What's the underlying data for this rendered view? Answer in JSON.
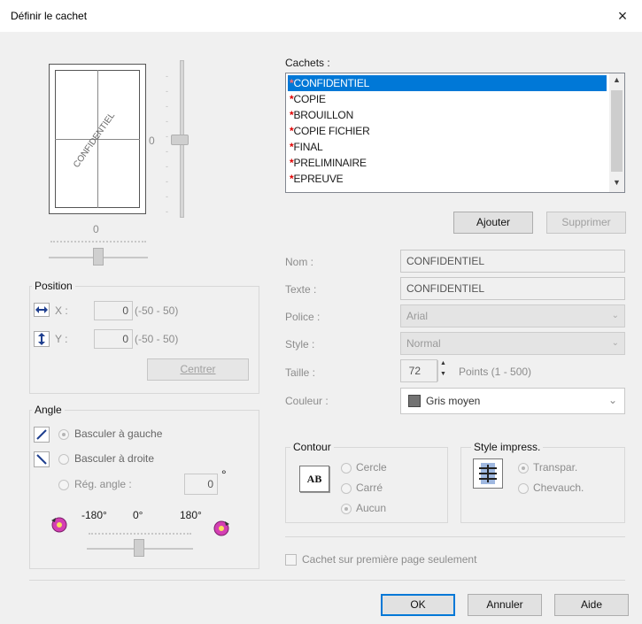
{
  "window": {
    "title": "Définir le cachet",
    "close_glyph": "×"
  },
  "preview": {
    "watermark_text": "CONFIDENTIEL",
    "vertical_value": "0",
    "horizontal_value": "0"
  },
  "stamps": {
    "label": "Cachets :",
    "items": [
      "CONFIDENTIEL",
      "COPIE",
      "BROUILLON",
      "COPIE FICHIER",
      "FINAL",
      "PRELIMINAIRE",
      "EPREUVE"
    ],
    "selected_index": 0,
    "add_button": "Ajouter",
    "delete_button": "Supprimer"
  },
  "props": {
    "name_label": "Nom :",
    "name_value": "CONFIDENTIEL",
    "text_label": "Texte :",
    "text_value": "CONFIDENTIEL",
    "font_label": "Police :",
    "font_value": "Arial",
    "style_label": "Style :",
    "style_value": "Normal",
    "size_label": "Taille :",
    "size_value": "72",
    "size_range": "Points (1 - 500)",
    "color_label": "Couleur :",
    "color_value": "Gris moyen",
    "color_swatch": "#737373"
  },
  "position": {
    "title": "Position",
    "x_label": "X :",
    "x_value": "0",
    "x_range": "(-50 - 50)",
    "y_label": "Y :",
    "y_value": "0",
    "y_range": "(-50 - 50)",
    "center_button": "Centrer"
  },
  "angle": {
    "title": "Angle",
    "option_left": "Basculer à gauche",
    "option_right": "Basculer à droite",
    "option_custom": "Rég. angle :",
    "custom_value": "0",
    "degree_symbol": "°",
    "min_label": "-180°",
    "mid_label": "0°",
    "max_label": "180°"
  },
  "outline": {
    "title": "Contour",
    "icon_text": "AB",
    "opt_circle": "Cercle",
    "opt_square": "Carré",
    "opt_none": "Aucun",
    "selected": "Aucun"
  },
  "print_style": {
    "title": "Style impress.",
    "opt_transparent": "Transpar.",
    "opt_overlap": "Chevauch.",
    "selected": "Transpar."
  },
  "first_page_only": {
    "label": "Cachet sur première page seulement",
    "checked": false
  },
  "footer": {
    "ok": "OK",
    "cancel": "Annuler",
    "help": "Aide"
  },
  "colors": {
    "accent": "#0078d7",
    "stamp_marker": "#e00000",
    "dialog_bg": "#f0f0f0"
  }
}
